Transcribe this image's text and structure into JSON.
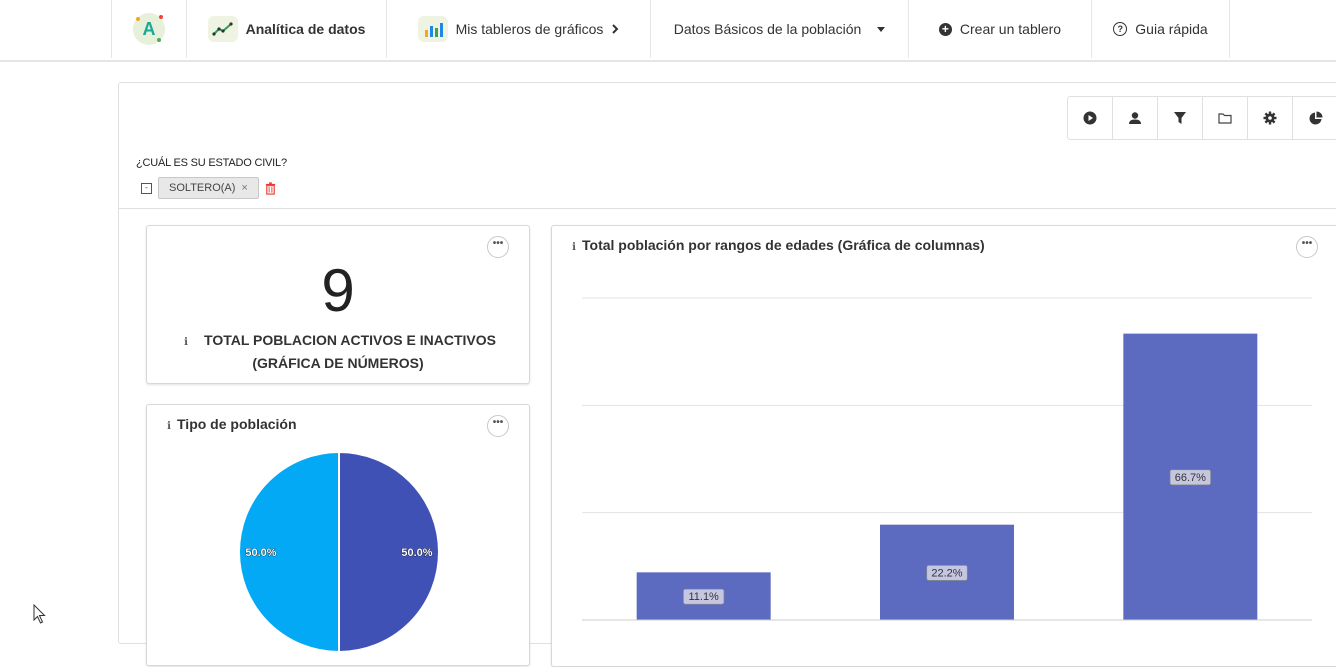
{
  "navbar": {
    "logo_letter": "A",
    "analitica_label": "Analítica de datos",
    "mis_tableros_label": "Mis tableros de gráficos",
    "dashboard_select_label": "Datos Básicos de la población",
    "crear_label": "Crear un tablero",
    "guia_label": "Guia rápida"
  },
  "toolbar": {
    "buttons": [
      "play-icon",
      "user-icon",
      "filter-icon",
      "folder-icon",
      "gear-icon",
      "pie-chart-icon"
    ]
  },
  "filter": {
    "question": "¿CUÁL ES SU ESTADO CIVIL?",
    "chip_label": "SOLTERO(A)",
    "chip_remove": "×"
  },
  "number_card": {
    "value": "9",
    "caption_line1": "TOTAL POBLACION ACTIVOS E INACTIVOS",
    "caption_line2": "(GRÁFICA DE NÚMEROS)"
  },
  "pie_card": {
    "title": "Tipo de población"
  },
  "bar_card": {
    "title": "Total población por rangos de edades (Gráfica de columnas)"
  },
  "colors": {
    "bar": "#5c6bc0",
    "pie_light": "#03a9f4",
    "pie_dark": "#3f51b5",
    "trash": "#e53935"
  },
  "chart_data": [
    {
      "type": "bar",
      "title": "Total población por rangos de edades (Gráfica de columnas)",
      "categories": [
        "",
        "",
        ""
      ],
      "values": [
        11.1,
        22.2,
        66.7
      ],
      "labels": [
        "11.1%",
        "22.2%",
        "66.7%"
      ],
      "ylim": [
        0,
        75
      ],
      "grid": true
    },
    {
      "type": "pie",
      "title": "Tipo de población",
      "values": [
        50.0,
        50.0
      ],
      "labels": [
        "50.0%",
        "50.0%"
      ]
    }
  ]
}
